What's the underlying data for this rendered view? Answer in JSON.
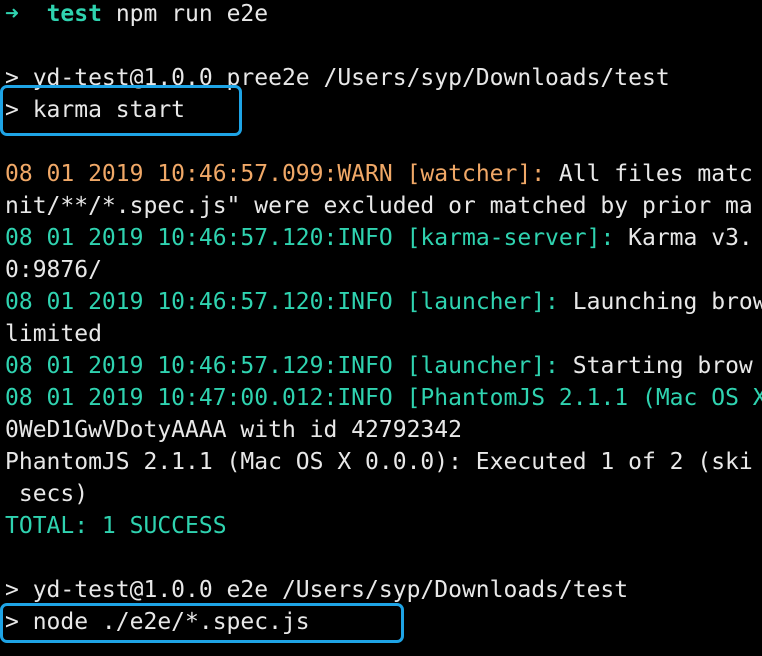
{
  "terminal": {
    "prompt": {
      "arrow": "➜",
      "dir": "test",
      "command": "npm run e2e"
    },
    "lines": [
      {
        "text": "> yd-test@1.0.0 pree2e /Users/syp/Downloads/test",
        "color": "white"
      },
      {
        "text": "> karma start",
        "color": "white"
      },
      {
        "text": "",
        "color": "white"
      },
      {
        "parts": [
          {
            "text": "08 01 2019 10:46:57.099:WARN ",
            "color": "orange"
          },
          {
            "text": "[watcher]: ",
            "color": "orange"
          },
          {
            "text": "All files matc",
            "color": "white"
          }
        ]
      },
      {
        "text": "nit/**/*.spec.js\" were excluded or matched by prior ma",
        "color": "white"
      },
      {
        "parts": [
          {
            "text": "08 01 2019 10:46:57.120:INFO ",
            "color": "green"
          },
          {
            "text": "[karma-server]: ",
            "color": "green"
          },
          {
            "text": "Karma v3.",
            "color": "white"
          }
        ]
      },
      {
        "text": "0:9876/",
        "color": "white"
      },
      {
        "parts": [
          {
            "text": "08 01 2019 10:46:57.120:INFO ",
            "color": "green"
          },
          {
            "text": "[launcher]: ",
            "color": "green"
          },
          {
            "text": "Launching brow",
            "color": "white"
          }
        ]
      },
      {
        "text": "limited",
        "color": "white"
      },
      {
        "parts": [
          {
            "text": "08 01 2019 10:46:57.129:INFO ",
            "color": "green"
          },
          {
            "text": "[launcher]: ",
            "color": "green"
          },
          {
            "text": "Starting brow",
            "color": "white"
          }
        ]
      },
      {
        "parts": [
          {
            "text": "08 01 2019 10:47:00.012:INFO ",
            "color": "green"
          },
          {
            "text": "[PhantomJS 2.1.1 (Mac OS X",
            "color": "green"
          }
        ]
      },
      {
        "text": "0WeD1GwVDotyAAAA with id 42792342",
        "color": "white"
      },
      {
        "text": "PhantomJS 2.1.1 (Mac OS X 0.0.0): Executed 1 of 2 (ski",
        "color": "white"
      },
      {
        "text": " secs)",
        "color": "white"
      },
      {
        "text": "TOTAL: 1 SUCCESS",
        "color": "green"
      },
      {
        "text": "",
        "color": "white"
      },
      {
        "text": "",
        "color": "white"
      },
      {
        "text": "> yd-test@1.0.0 e2e /Users/syp/Downloads/test",
        "color": "white"
      },
      {
        "text": "> node ./e2e/*.spec.js",
        "color": "white"
      }
    ],
    "highlights": [
      "karma start",
      "node ./e2e/*.spec.js"
    ]
  },
  "colors": {
    "background": "#000000",
    "text": "#e8e8e8",
    "green": "#2fd3b0",
    "orange": "#f0a867",
    "highlight_border": "#1ea4e6"
  }
}
